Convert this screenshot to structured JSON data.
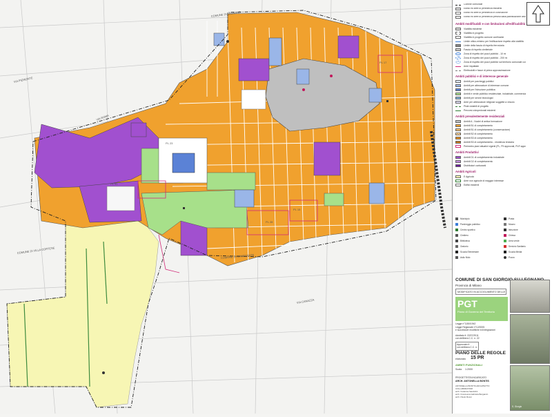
{
  "map": {
    "street_labels": [
      "COMUNE DI LEGNANO",
      "VIA ROMA",
      "VIA PIEMONTE",
      "VIA CANAZZA",
      "COMUNE DI CANEGRATE",
      "COMUNE DI VILLA CORTESE",
      "PL 23",
      "PL 31",
      "PL 28",
      "PL 15",
      "PL 17"
    ]
  },
  "legend": {
    "top_items": [
      "Confine comunale",
      "Edifici ed aree di pertinenza esistenti",
      "Edifici ed aree di pertinenza in costruzione",
      "Edifici ed aree di pertinenza previsti dalla pianificazione attuativa"
    ],
    "section_limits": "Ambiti modificabili e con limitazioni all'edificabilità",
    "limits_items": [
      "Viabilità esistente",
      "Viabilità in progetto",
      "Viabilità in progetto comune confinante",
      "Limite ottico-minimo per l'edificazione rispetto alla viabilità",
      "Limite della fascia di rispetto ferroviaria",
      "Fascia di rispetto cimiteriale",
      "Zona di rispetto dei pozzi pubblici - 10 ml",
      "Zona di rispetto dei pozzi pubblici - 200 ml",
      "Zona di rispetto dei pozzi pubblici sul territorio comunale confinante - 200 ml",
      "Aree impattate",
      "Elettrodotti e fasce di prima approssimazione"
    ],
    "section_public": "Ambiti pubblici e di interesse generale",
    "public_items": [
      "Ambiti per parcheggi pubblici",
      "Ambiti per attrezzature di interesse comune",
      "Ambiti per l'istruzione pubblica",
      "Ambiti e verde pubblico residenziale, industriale, commerciale",
      "Ambiti per servizi tecnologici",
      "Aree per attrezzature religiose soggette a vincolo",
      "Piste ciclabili di progetto",
      "Percorsi ciclopedonali esistenti"
    ],
    "section_residential": "Ambiti prevalentemente residenziali",
    "residential_items": [
      "Ambiti A - Nuclei di antica formazione",
      "Ambiti B1 di completamento",
      "Ambiti B1 di completamento (conservazione)",
      "Ambiti B2 di completamento",
      "Ambiti B3 di completamento",
      "Ambiti B3 di completamento - residenza terziaria",
      "Perimetro piani attuativi vigenti (PL, PII approvati, PLR approvati, PA, PR)"
    ],
    "section_productive": "Ambiti Produttivi",
    "productive_items": [
      "Ambiti D1 di completamento industriale",
      "Ambiti D2 di completamento",
      "Distributori carburanti"
    ],
    "section_agricultural": "Ambiti Agricoli",
    "agricultural_items": [
      "E Agricolo",
      "Aree non agricole di maggior interesse",
      "Edifici esistenti"
    ],
    "symbols": [
      "Municipio",
      "Posta",
      "Parcheggio pubblico",
      "Museo",
      "Centro sportivo",
      "Istruzione",
      "Cimitero",
      "Chiesa",
      "Biblioteca",
      "Area verde",
      "Oratorio",
      "Servizio Sanitario",
      "Scuola Elementare",
      "Scuola Media",
      "Asilo Nido",
      "Pozzo"
    ]
  },
  "title_block": {
    "comune": "COMUNE DI SAN GIORGIO SU LEGNANO",
    "provincia": "Provincia di Milano",
    "status_box": "MODIFICATO IN ACCOGLIMENTO DELLE OSSERVAZIONI",
    "pgt": "PGT",
    "pgt_sub": "Piano di Governo del Territorio",
    "law_lines": [
      "Legge n°1150/1942",
      "Legge Regionale n°12/2005",
      "e successive modifiche ed integrazioni"
    ],
    "adoption_lines": [
      "Adottato il: 22/07/2011",
      "con delibera C.C. n. 22"
    ],
    "approval_lines": [
      "Approvato il:",
      "con delibera C.C. n."
    ],
    "doc_title": "PIANO DELLE REGOLE",
    "elaborato_label": "elaborato",
    "elaborato_value": "15 PR",
    "subtitle": "AMBITI FUNZIONALI",
    "scale_label": "Scala",
    "scale_value": "1:2000",
    "designer_label": "PROGETTISTA INCARICATO",
    "designer": "ARCH. ANTONELLA BONTIS",
    "team": [
      "ANTONELLA BONTIS ARCHITETTO",
      "COLLABORATORI",
      "arch. Federica Sandolini",
      "arch. Francesca Gabriela Bergamin",
      "arch. Paolo Rossi"
    ],
    "photo_caption": "S. Giorgio"
  },
  "colors": {
    "orange_b1": "#f0a12e",
    "purple_d1": "#a150cf",
    "green_park": "#a7e08a",
    "blue_public": "#9ab6e8",
    "yellow_agri": "#f7f6b4",
    "grey_core": "#bfbfbf",
    "title_green": "#9bd37e",
    "accent_magenta": "#c2185b"
  }
}
